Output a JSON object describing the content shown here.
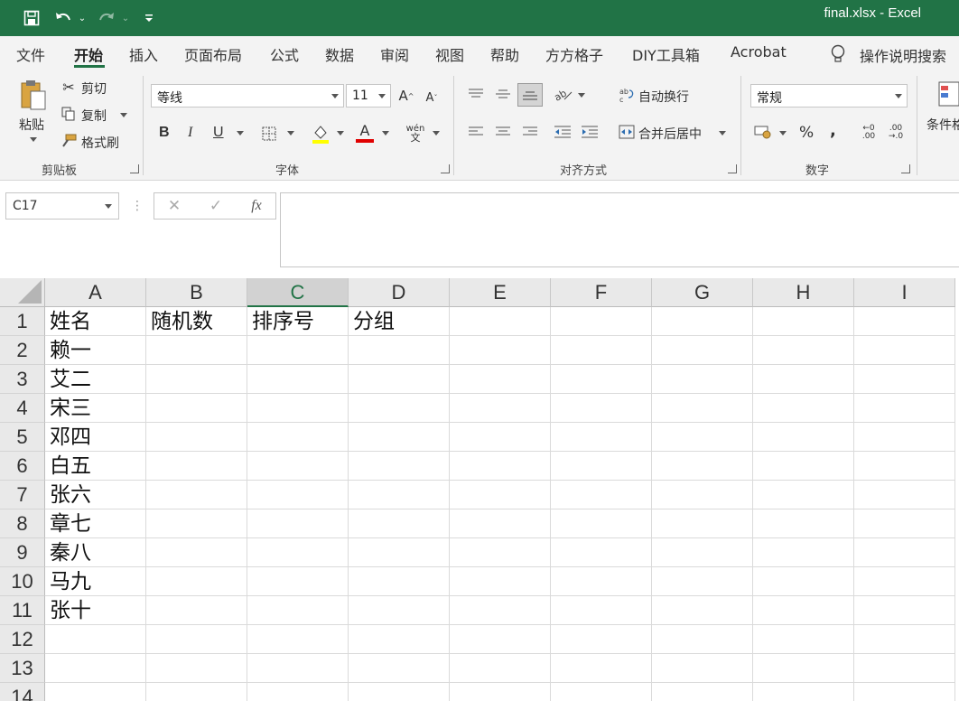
{
  "title_bar": {
    "title": "final.xlsx  -  Excel",
    "save_icon": "save-icon",
    "undo_icon": "undo-icon",
    "redo_icon": "redo-icon",
    "customize_icon": "customize-quick-access-icon",
    "bg_color": "#217346"
  },
  "tabs": [
    "文件",
    "开始",
    "插入",
    "页面布局",
    "公式",
    "数据",
    "审阅",
    "视图",
    "帮助",
    "方方格子",
    "DIY工具箱",
    "Acrobat"
  ],
  "active_tab": "开始",
  "tell_me": "操作说明搜索",
  "ribbon": {
    "clipboard": {
      "paste": "粘贴",
      "cut": "剪切",
      "copy": "复制",
      "format_painter": "格式刷",
      "group_label": "剪贴板"
    },
    "font": {
      "font_name": "等线",
      "font_size": "11",
      "bold": "B",
      "italic": "I",
      "underline": "U",
      "font_color_letter": "A",
      "group_label": "字体"
    },
    "alignment": {
      "wrap_text": "自动换行",
      "merge_center": "合并后居中",
      "group_label": "对齐方式"
    },
    "number": {
      "format": "常规",
      "percent": "%",
      "comma": ",",
      "group_label": "数字"
    },
    "styles": {
      "conditional": "条件格"
    }
  },
  "formula_bar": {
    "name_box": "C17",
    "cancel": "✕",
    "enter": "✓",
    "fx": "fx",
    "content": ""
  },
  "sheet": {
    "columns": [
      "A",
      "B",
      "C",
      "D",
      "E",
      "F",
      "G",
      "H",
      "I"
    ],
    "selected_column": "C",
    "row_numbers": [
      "1",
      "2",
      "3",
      "4",
      "5",
      "6",
      "7",
      "8",
      "9",
      "10",
      "11",
      "12",
      "13",
      "14"
    ],
    "cells": {
      "A1": "姓名",
      "B1": "随机数",
      "C1": "排序号",
      "D1": "分组",
      "A2": "赖一",
      "A3": "艾二",
      "A4": "宋三",
      "A5": "邓四",
      "A6": "白五",
      "A7": "张六",
      "A8": "章七",
      "A9": "秦八",
      "A10": "马九",
      "A11": "张十"
    }
  }
}
